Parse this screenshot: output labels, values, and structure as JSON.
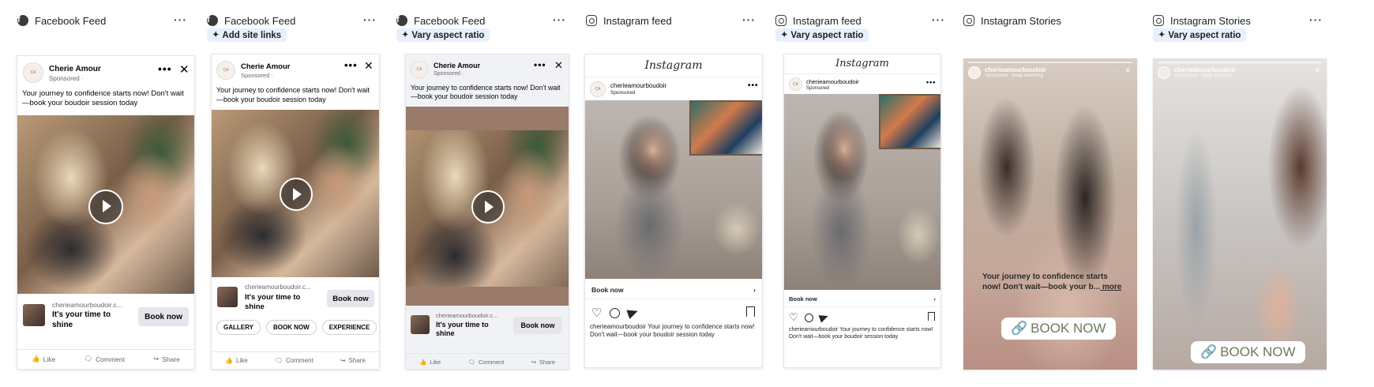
{
  "columns": [
    {
      "platform": "Facebook Feed",
      "platform_icon": "facebook-icon",
      "badge": null
    },
    {
      "platform": "Facebook Feed",
      "platform_icon": "facebook-icon",
      "badge": "Add site links"
    },
    {
      "platform": "Facebook Feed",
      "platform_icon": "facebook-icon",
      "badge": "Vary aspect ratio"
    },
    {
      "platform": "Instagram feed",
      "platform_icon": "instagram-icon",
      "badge": null
    },
    {
      "platform": "Instagram feed",
      "platform_icon": "instagram-icon",
      "badge": "Vary aspect ratio"
    },
    {
      "platform": "Instagram Stories",
      "platform_icon": "instagram-icon",
      "badge": null
    },
    {
      "platform": "Instagram Stories",
      "platform_icon": "instagram-icon",
      "badge": "Vary aspect ratio"
    }
  ],
  "ad": {
    "page_name": "Cherie Amour",
    "sponsored": "Sponsored · ",
    "primary_text": "Your journey to confidence starts now! Don't wait—book your boudoir session today",
    "domain": "cherieamourboudoir.c...",
    "headline": "It's your time to shine",
    "cta": "Book now",
    "site_links": [
      "GALLERY",
      "BOOK NOW",
      "EXPERIENCE"
    ],
    "actions": {
      "like": "Like",
      "comment": "Comment",
      "share": "Share"
    }
  },
  "instagram": {
    "logo": "Instagram",
    "handle": "cherieamourboudoir",
    "sponsored": "Sponsored",
    "book_now": "Book now",
    "caption_handle": "cherieamourboudoir",
    "caption": " Your journey to confidence starts now! Don't wait—book your boudoir session today"
  },
  "stories": {
    "handle": "cherieamourboudoir",
    "sub": "Sponsored · Keep watching",
    "text": "Your journey to confidence starts now! Don't wait—book your b...",
    "more": " more",
    "cta": "BOOK NOW"
  },
  "colors": {
    "fb_blue": "#1877f2",
    "badge_bg": "#e7f0fc",
    "cta_green": "#6a7a5a"
  }
}
